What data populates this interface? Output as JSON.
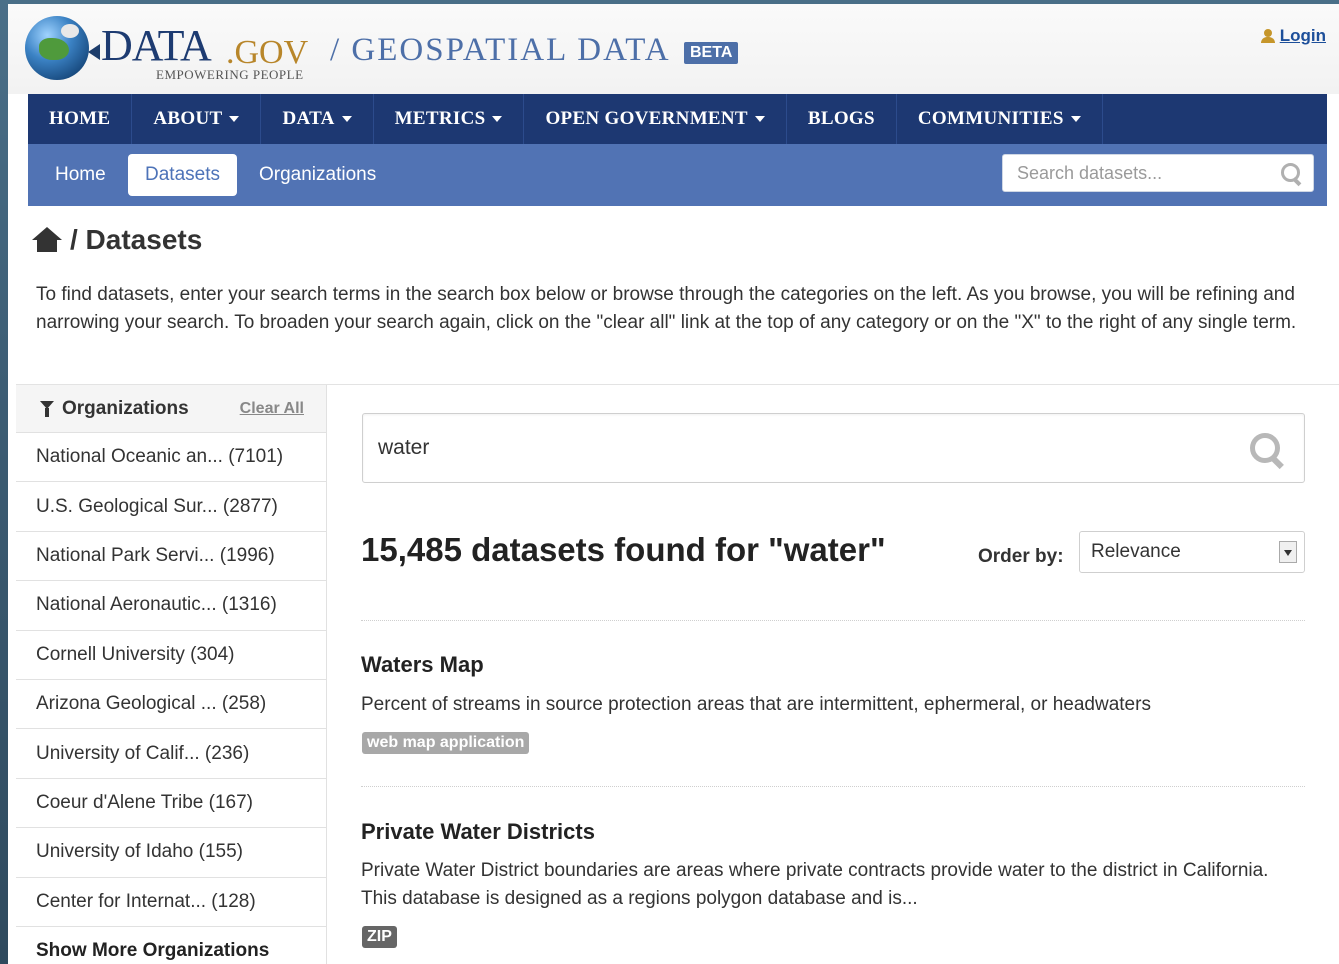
{
  "header": {
    "brand_main": "DATA",
    "brand_suffix": ".GOV",
    "brand_tagline": "EMPOWERING PEOPLE",
    "site_title": "/ GEOSPATIAL DATA",
    "beta_label": "BETA",
    "login_label": "Login"
  },
  "main_nav": {
    "items": [
      {
        "label": "HOME",
        "dropdown": false
      },
      {
        "label": "ABOUT",
        "dropdown": true
      },
      {
        "label": "DATA",
        "dropdown": true
      },
      {
        "label": "METRICS",
        "dropdown": true
      },
      {
        "label": "OPEN GOVERNMENT",
        "dropdown": true
      },
      {
        "label": "BLOGS",
        "dropdown": false
      },
      {
        "label": "COMMUNITIES",
        "dropdown": true
      }
    ]
  },
  "sub_nav": {
    "tabs": [
      {
        "label": "Home",
        "active": false
      },
      {
        "label": "Datasets",
        "active": true
      },
      {
        "label": "Organizations",
        "active": false
      }
    ],
    "search_placeholder": "Search datasets..."
  },
  "page": {
    "breadcrumb": "/ Datasets",
    "intro": "To find datasets, enter your search terms in the search box below or browse through the categories on the left. As you browse, you will be refining and narrowing your search. To broaden your search again, click on the \"clear all\" link at the top of any category or on the \"X\" to the right of any single term."
  },
  "sidebar": {
    "title": "Organizations",
    "clear_all": "Clear All",
    "items": [
      "National Oceanic an... (7101)",
      "U.S. Geological Sur... (2877)",
      "National Park Servi... (1996)",
      "National Aeronautic... (1316)",
      "Cornell University (304)",
      "Arizona Geological ... (258)",
      "University of Calif... (236)",
      "Coeur d'Alene Tribe (167)",
      "University of Idaho (155)",
      "Center for Internat... (128)"
    ],
    "show_more": "Show More Organizations"
  },
  "search": {
    "query": "water",
    "result_count": "15,485 datasets found for \"water\"",
    "order_label": "Order by:",
    "order_value": "Relevance"
  },
  "results": [
    {
      "title": "Waters Map",
      "description": "Percent of streams in source protection areas that are intermittent, ephermeral, or headwaters",
      "tag": "web map application"
    },
    {
      "title": "Private Water Districts",
      "description": "Private Water District boundaries are areas where private contracts provide water to the district in California. This database is designed as a regions polygon database and is...",
      "tag": "ZIP"
    }
  ],
  "colors": {
    "main_nav_bg": "#1d3872",
    "sub_nav_bg": "#5173b4",
    "brand_blue": "#1d3b71",
    "brand_gold": "#b8862a"
  }
}
